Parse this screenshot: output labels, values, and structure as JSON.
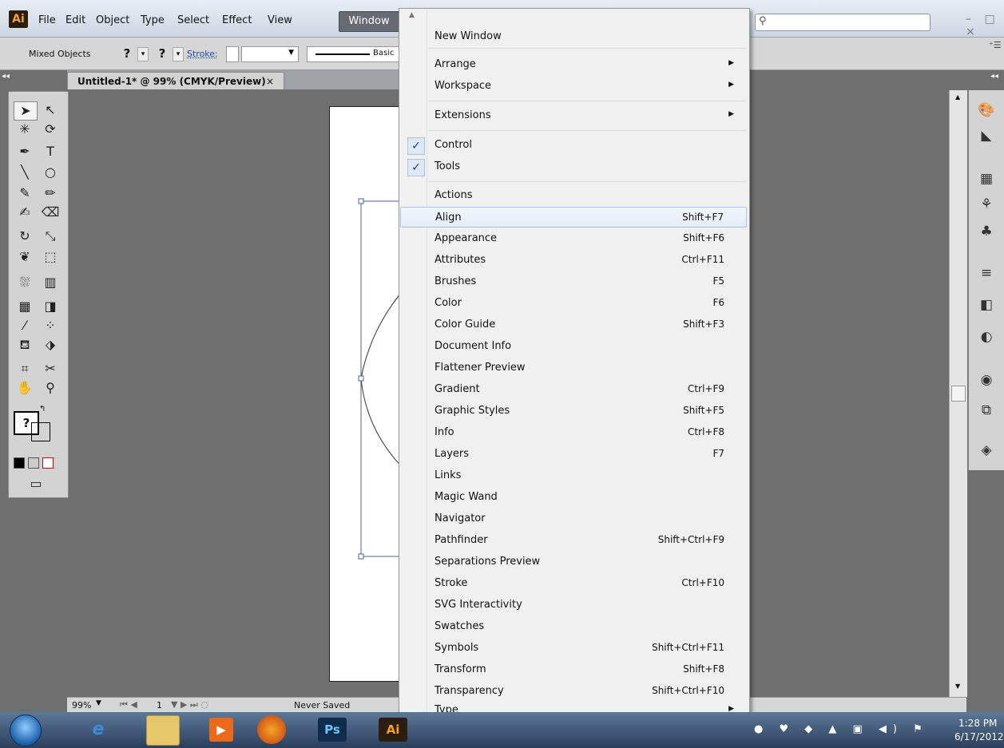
{
  "app": {
    "logo": "Ai",
    "menus": [
      "File",
      "Edit",
      "Object",
      "Type",
      "Select",
      "Effect",
      "View",
      "Window"
    ],
    "active_menu": "Window",
    "search_placeholder": "",
    "window_controls": "– □ ×"
  },
  "control_bar": {
    "selection_label": "Mixed Objects",
    "fill_symbol": "?",
    "stroke_symbol": "?",
    "stroke_label": "Stroke:",
    "brush_label": "Basic"
  },
  "document": {
    "tab_title": "Untitled-1* @ 99% (CMYK/Preview)",
    "tab_close": "×"
  },
  "status_bar": {
    "zoom": "99%",
    "page": "1",
    "status": "Never Saved"
  },
  "window_menu": {
    "items": [
      {
        "label": "New Window",
        "shortcut": "",
        "submenu": false,
        "checked": false
      },
      {
        "label": "Arrange",
        "shortcut": "",
        "submenu": true,
        "checked": false
      },
      {
        "label": "Workspace",
        "shortcut": "",
        "submenu": true,
        "checked": false
      },
      {
        "label": "Extensions",
        "shortcut": "",
        "submenu": true,
        "checked": false
      },
      {
        "label": "Control",
        "shortcut": "",
        "submenu": false,
        "checked": true
      },
      {
        "label": "Tools",
        "shortcut": "",
        "submenu": false,
        "checked": true
      },
      {
        "label": "Actions",
        "shortcut": "",
        "submenu": false,
        "checked": false
      },
      {
        "label": "Align",
        "shortcut": "Shift+F7",
        "submenu": false,
        "checked": false,
        "highlighted": true
      },
      {
        "label": "Appearance",
        "shortcut": "Shift+F6",
        "submenu": false,
        "checked": false
      },
      {
        "label": "Attributes",
        "shortcut": "Ctrl+F11",
        "submenu": false,
        "checked": false
      },
      {
        "label": "Brushes",
        "shortcut": "F5",
        "submenu": false,
        "checked": false
      },
      {
        "label": "Color",
        "shortcut": "F6",
        "submenu": false,
        "checked": false
      },
      {
        "label": "Color Guide",
        "shortcut": "Shift+F3",
        "submenu": false,
        "checked": false
      },
      {
        "label": "Document Info",
        "shortcut": "",
        "submenu": false,
        "checked": false
      },
      {
        "label": "Flattener Preview",
        "shortcut": "",
        "submenu": false,
        "checked": false
      },
      {
        "label": "Gradient",
        "shortcut": "Ctrl+F9",
        "submenu": false,
        "checked": false
      },
      {
        "label": "Graphic Styles",
        "shortcut": "Shift+F5",
        "submenu": false,
        "checked": false
      },
      {
        "label": "Info",
        "shortcut": "Ctrl+F8",
        "submenu": false,
        "checked": false
      },
      {
        "label": "Layers",
        "shortcut": "F7",
        "submenu": false,
        "checked": false
      },
      {
        "label": "Links",
        "shortcut": "",
        "submenu": false,
        "checked": false
      },
      {
        "label": "Magic Wand",
        "shortcut": "",
        "submenu": false,
        "checked": false
      },
      {
        "label": "Navigator",
        "shortcut": "",
        "submenu": false,
        "checked": false
      },
      {
        "label": "Pathfinder",
        "shortcut": "Shift+Ctrl+F9",
        "submenu": false,
        "checked": false
      },
      {
        "label": "Separations Preview",
        "shortcut": "",
        "submenu": false,
        "checked": false
      },
      {
        "label": "Stroke",
        "shortcut": "Ctrl+F10",
        "submenu": false,
        "checked": false
      },
      {
        "label": "SVG Interactivity",
        "shortcut": "",
        "submenu": false,
        "checked": false
      },
      {
        "label": "Swatches",
        "shortcut": "",
        "submenu": false,
        "checked": false
      },
      {
        "label": "Symbols",
        "shortcut": "Shift+Ctrl+F11",
        "submenu": false,
        "checked": false
      },
      {
        "label": "Transform",
        "shortcut": "Shift+F8",
        "submenu": false,
        "checked": false
      },
      {
        "label": "Transparency",
        "shortcut": "Shift+Ctrl+F10",
        "submenu": false,
        "checked": false
      },
      {
        "label": "Type",
        "shortcut": "",
        "submenu": true,
        "checked": false
      }
    ]
  },
  "taskbar": {
    "apps": [
      "Ps",
      "Ai"
    ],
    "time": "1:28 PM",
    "date": "6/17/2012"
  },
  "icons": {
    "check": "✓",
    "submenu_arrow": "▶",
    "scroll_up": "▲",
    "scroll_down": "▼",
    "search": "⚲"
  }
}
